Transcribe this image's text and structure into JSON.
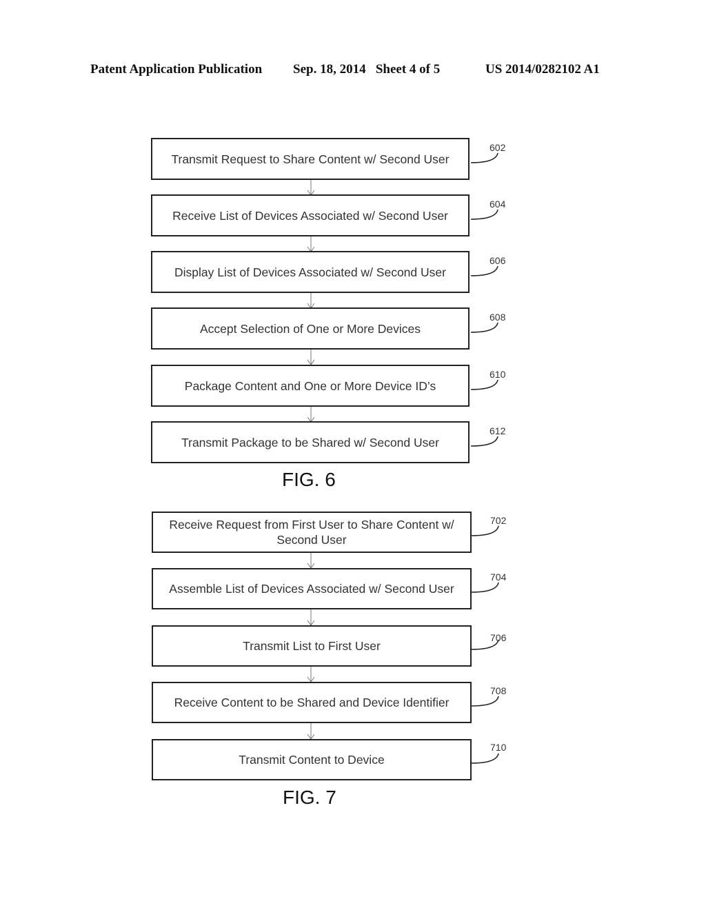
{
  "header": {
    "publication": "Patent Application Publication",
    "date_sheet": "Sep. 18, 2014   Sheet 4 of 5",
    "number": "US 2014/0282102 A1"
  },
  "fig6": {
    "caption": "FIG. 6",
    "steps": [
      {
        "ref": "602",
        "text": "Transmit Request to Share Content w/ Second User"
      },
      {
        "ref": "604",
        "text": "Receive List of Devices Associated w/ Second User"
      },
      {
        "ref": "606",
        "text": "Display List of Devices Associated w/ Second User"
      },
      {
        "ref": "608",
        "text": "Accept Selection of One or More Devices"
      },
      {
        "ref": "610",
        "text": "Package Content and One or More Device ID’s"
      },
      {
        "ref": "612",
        "text": "Transmit Package to be Shared w/ Second User"
      }
    ]
  },
  "fig7": {
    "caption": "FIG. 7",
    "steps": [
      {
        "ref": "702",
        "text": "Receive Request from First User to Share Content w/ Second User"
      },
      {
        "ref": "704",
        "text": "Assemble List of Devices Associated w/ Second User"
      },
      {
        "ref": "706",
        "text": "Transmit List to First User"
      },
      {
        "ref": "708",
        "text": "Receive Content to be Shared and Device Identifier"
      },
      {
        "ref": "710",
        "text": "Transmit Content to Device"
      }
    ]
  }
}
